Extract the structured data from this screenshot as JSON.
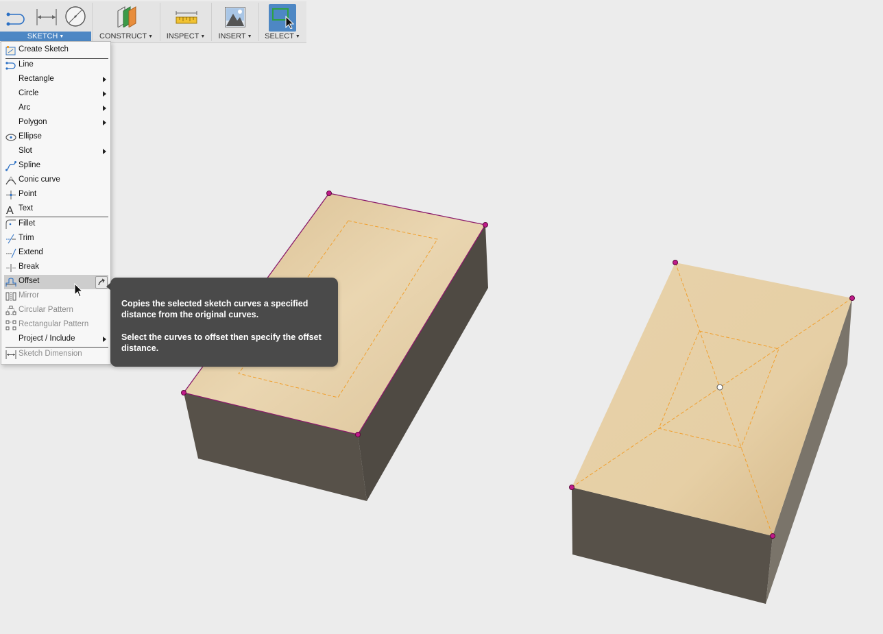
{
  "toolbar": {
    "sketch": {
      "label": "SKETCH",
      "icons": [
        "line-icon",
        "dimension-icon",
        "circle-icon"
      ]
    },
    "construct": {
      "label": "CONSTRUCT",
      "icon": "construct-plane-icon"
    },
    "inspect": {
      "label": "INSPECT",
      "icon": "measure-ruler-icon"
    },
    "insert": {
      "label": "INSERT",
      "icon": "insert-image-icon"
    },
    "select": {
      "label": "SELECT",
      "icon": "select-window-icon",
      "active": true
    }
  },
  "sketch_menu": {
    "items": [
      {
        "id": "create-sketch",
        "label": "Create Sketch",
        "icon": "create-sketch-icon",
        "submenu": false,
        "enabled": true
      },
      {
        "id": "line",
        "label": "Line",
        "icon": "line-icon",
        "submenu": false,
        "enabled": true
      },
      {
        "id": "rectangle",
        "label": "Rectangle",
        "icon": "",
        "submenu": true,
        "enabled": true
      },
      {
        "id": "circle",
        "label": "Circle",
        "icon": "",
        "submenu": true,
        "enabled": true
      },
      {
        "id": "arc",
        "label": "Arc",
        "icon": "",
        "submenu": true,
        "enabled": true
      },
      {
        "id": "polygon",
        "label": "Polygon",
        "icon": "",
        "submenu": true,
        "enabled": true
      },
      {
        "id": "ellipse",
        "label": "Ellipse",
        "icon": "ellipse-icon",
        "submenu": false,
        "enabled": true
      },
      {
        "id": "slot",
        "label": "Slot",
        "icon": "",
        "submenu": true,
        "enabled": true
      },
      {
        "id": "spline",
        "label": "Spline",
        "icon": "spline-icon",
        "submenu": false,
        "enabled": true
      },
      {
        "id": "conic-curve",
        "label": "Conic curve",
        "icon": "conic-curve-icon",
        "submenu": false,
        "enabled": true
      },
      {
        "id": "point",
        "label": "Point",
        "icon": "point-icon",
        "submenu": false,
        "enabled": true
      },
      {
        "id": "text",
        "label": "Text",
        "icon": "text-icon",
        "submenu": false,
        "enabled": true
      },
      {
        "id": "fillet",
        "label": "Fillet",
        "icon": "fillet-icon",
        "submenu": false,
        "enabled": true
      },
      {
        "id": "trim",
        "label": "Trim",
        "icon": "trim-icon",
        "submenu": false,
        "enabled": true
      },
      {
        "id": "extend",
        "label": "Extend",
        "icon": "extend-icon",
        "submenu": false,
        "enabled": true
      },
      {
        "id": "break",
        "label": "Break",
        "icon": "break-icon",
        "submenu": false,
        "enabled": true
      },
      {
        "id": "offset",
        "label": "Offset",
        "icon": "offset-icon",
        "submenu": false,
        "enabled": true,
        "highlighted": true
      },
      {
        "id": "mirror",
        "label": "Mirror",
        "icon": "mirror-icon",
        "submenu": false,
        "enabled": false
      },
      {
        "id": "circular-pattern",
        "label": "Circular Pattern",
        "icon": "circular-pattern-icon",
        "submenu": false,
        "enabled": false
      },
      {
        "id": "rectangular-pattern",
        "label": "Rectangular Pattern",
        "icon": "rectangular-pattern-icon",
        "submenu": false,
        "enabled": false
      },
      {
        "id": "project-include",
        "label": "Project / Include",
        "icon": "",
        "submenu": true,
        "enabled": true
      },
      {
        "id": "sketch-dimension",
        "label": "Sketch Dimension",
        "icon": "sketch-dimension-icon",
        "submenu": false,
        "enabled": false
      }
    ]
  },
  "tooltip": {
    "paragraph1": "Copies the selected sketch curves a specified distance from the original curves.",
    "paragraph2": "Select the curves to offset then specify the offset distance."
  },
  "colors": {
    "face_top": "#e6cfa5",
    "face_side_dark": "#575149",
    "sketch_line": "#f0a030",
    "edge_highlight": "#8a1a6a",
    "toolbar_active": "#4d87c4",
    "tooltip_bg": "#4a4a4a"
  }
}
